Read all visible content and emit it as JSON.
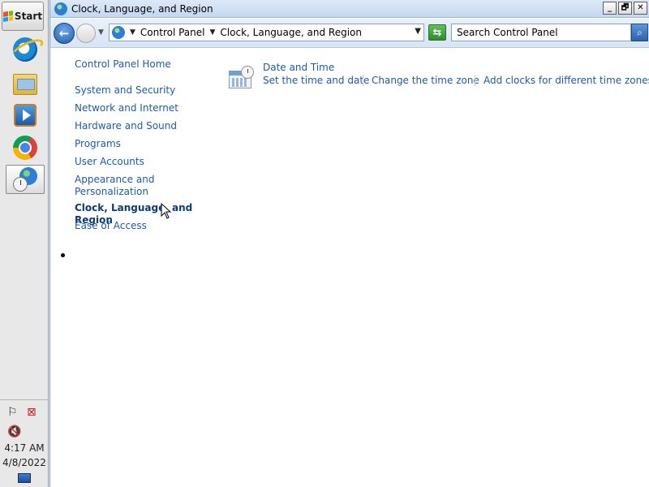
{
  "taskbar": {
    "start_label": "Start",
    "apps": [
      "internet-explorer",
      "file-explorer",
      "media-player",
      "chrome",
      "control-panel"
    ],
    "active_app": "control-panel",
    "tray": {
      "time": "4:17 AM",
      "date": "4/8/2022"
    }
  },
  "window": {
    "title": "Clock, Language, and Region",
    "controls": {
      "minimize": "_",
      "maximize": "🗗",
      "close": "✕"
    }
  },
  "navbar": {
    "breadcrumb": [
      "Control Panel",
      "Clock, Language, and Region"
    ],
    "search_placeholder": "Search Control Panel"
  },
  "leftnav": {
    "items": [
      {
        "label": "Control Panel Home"
      },
      {
        "label": "System and Security"
      },
      {
        "label": "Network and Internet"
      },
      {
        "label": "Hardware and Sound"
      },
      {
        "label": "Programs"
      },
      {
        "label": "User Accounts"
      },
      {
        "label": "Appearance and"
      },
      {
        "label": "Personalization"
      },
      {
        "label": "Clock, Language, and Region",
        "current": true
      },
      {
        "label": "Ease of Access"
      }
    ]
  },
  "main": {
    "category": {
      "title": "Date and Time",
      "icon": "date-time-icon",
      "tasks": [
        "Set the time and date",
        "Change the time zone",
        "Add clocks for different time zones"
      ]
    }
  },
  "colors": {
    "link": "#1e5aa6",
    "titlebar": "#c5d8ef"
  }
}
